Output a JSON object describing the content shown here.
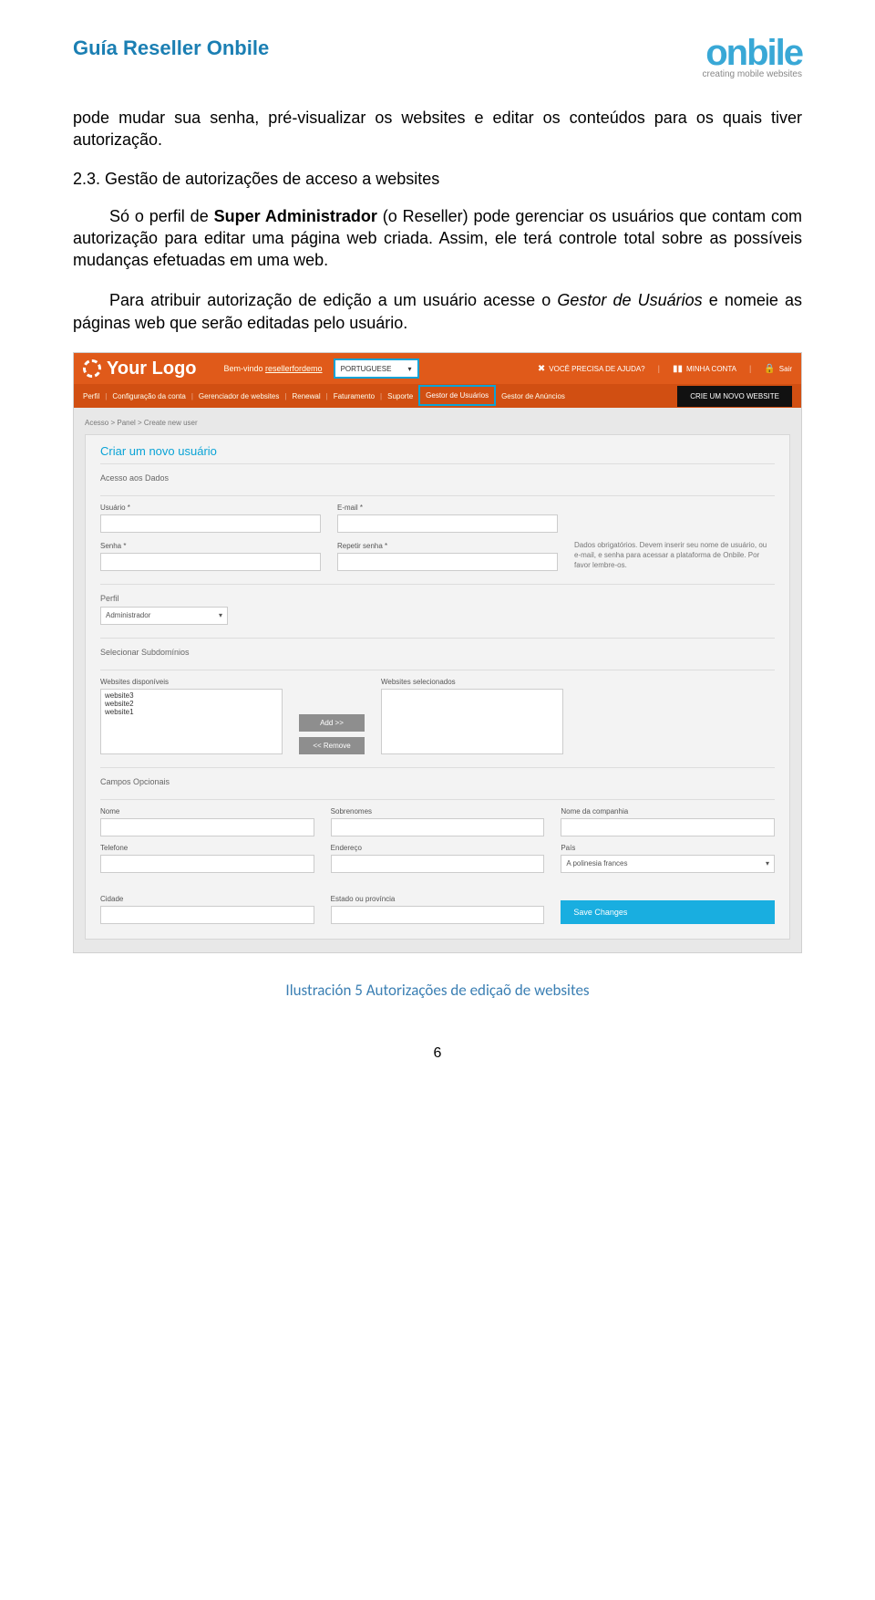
{
  "doc": {
    "title": "Guía Reseller Onbile",
    "logo_text": "onbile",
    "logo_tag": "creating mobile websites",
    "para1": "pode mudar sua senha, pré-visualizar os websites e editar os conteúdos para os quais tiver autorização.",
    "sec_num": "2.3.",
    "sec_title": "Gestão de autorizações de acceso a websites",
    "para2a": "Só o perfil de ",
    "para2b": "Super Administrador",
    "para2c": " (o Reseller) pode gerenciar os usuários que contam com autorização para editar uma página web criada. Assim, ele terá controle total sobre as possíveis mudanças efetuadas em uma web.",
    "para3a": "Para atribuir autorização de edição a um usuário acesse o ",
    "para3b": "Gestor de Usuários",
    "para3c": " e nomeie as páginas web que serão editadas pelo usuário.",
    "caption_label": "Ilustración 5",
    "caption_text": "Autorizações de ediçaõ de websites",
    "page": "6"
  },
  "app": {
    "brand": "Your Logo",
    "welcome_pre": "Bem-vindo ",
    "welcome_user": "resellerfordemo",
    "lang": "PORTUGUESE",
    "help": "VOCÊ PRECISA DE AJUDA?",
    "account": "MINHA CONTA",
    "exit": "Sair",
    "nav": {
      "perfil": "Perfil",
      "config": "Configuração da conta",
      "gerenc": "Gerenciador de websites",
      "renewal": "Renewal",
      "fatur": "Faturamento",
      "suporte": "Suporte",
      "gestor_u": "Gestor de Usuários",
      "gestor_a": "Gestor de Anúncios",
      "cta": "CRIE UM NOVO WEBSITE"
    },
    "breadcrumb": "Acesso > Panel > Create new user",
    "panel_title": "Criar um novo usuário",
    "sec_access": "Acesso aos Dados",
    "lbl_user": "Usuário *",
    "lbl_email": "E-mail *",
    "lbl_pass": "Senha *",
    "lbl_pass2": "Repetir senha *",
    "note": "Dados obrigatórios. Devem inserir seu nome de usuário, ou e-mail, e senha para acessar a plataforma de Onbile. Por favor lembre-os.",
    "lbl_perfil": "Perfil",
    "perfil_value": "Administrador",
    "sec_sub": "Selecionar Subdomínios",
    "lbl_avail": "Websites disponíveis",
    "lbl_selw": "Websites selecionados",
    "sites": [
      "website3",
      "website2",
      "website1"
    ],
    "btn_add": "Add >>",
    "btn_rem": "<< Remove",
    "sec_opt": "Campos Opcionais",
    "lbl_nome": "Nome",
    "lbl_sobr": "Sobrenomes",
    "lbl_comp": "Nome da companhia",
    "lbl_tel": "Telefone",
    "lbl_end": "Endereço",
    "lbl_pais": "País",
    "pais_value": "A polinesia frances",
    "lbl_cid": "Cidade",
    "lbl_est": "Estado ou província",
    "btn_save": "Save Changes"
  }
}
